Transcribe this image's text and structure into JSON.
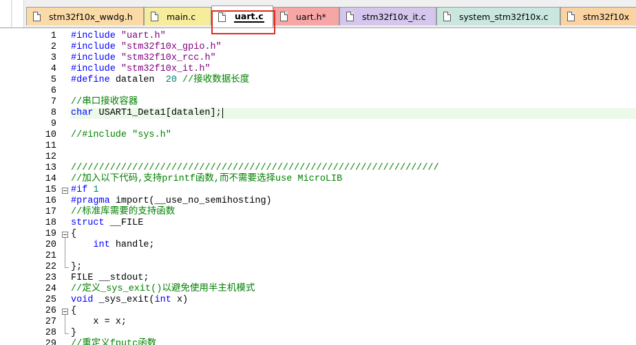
{
  "tabs": [
    {
      "label": "stm32f10x_wwdg.h",
      "color": "#fadba8",
      "active": false
    },
    {
      "label": "main.c",
      "color": "#f7ec9c",
      "active": false
    },
    {
      "label": "uart.c",
      "color": "#ffffff",
      "active": true
    },
    {
      "label": "uart.h*",
      "color": "#f7a6a6",
      "active": false
    },
    {
      "label": "stm32f10x_it.c",
      "color": "#d4c6ec",
      "active": false
    },
    {
      "label": "system_stm32f10x.c",
      "color": "#c9e6df",
      "active": false
    },
    {
      "label": "stm32f10x",
      "color": "#fad3a2",
      "active": false
    }
  ],
  "colors": {
    "keyword": "#0000ff",
    "string": "#800080",
    "comment": "#008000",
    "number": "#008080",
    "current_line": "#ecfaea",
    "highlight_box": "#e0281e"
  },
  "editor": {
    "current_line": 8,
    "lines": [
      {
        "n": "1",
        "fold": "",
        "tokens": [
          [
            "pp",
            "#include "
          ],
          [
            "str",
            "\"uart.h\""
          ]
        ]
      },
      {
        "n": "2",
        "fold": "",
        "tokens": [
          [
            "pp",
            "#include "
          ],
          [
            "str",
            "\"stm32f10x_gpio.h\""
          ]
        ]
      },
      {
        "n": "3",
        "fold": "",
        "tokens": [
          [
            "pp",
            "#include "
          ],
          [
            "str",
            "\"stm32f10x_rcc.h\""
          ]
        ]
      },
      {
        "n": "4",
        "fold": "",
        "tokens": [
          [
            "pp",
            "#include "
          ],
          [
            "str",
            "\"stm32f10x_it.h\""
          ]
        ]
      },
      {
        "n": "5",
        "fold": "",
        "tokens": [
          [
            "pp",
            "#define "
          ],
          [
            "t",
            "datalen  "
          ],
          [
            "num",
            "20"
          ],
          [
            "t",
            " "
          ],
          [
            "cm",
            "//接收数据长度"
          ]
        ]
      },
      {
        "n": "6",
        "fold": "",
        "tokens": []
      },
      {
        "n": "7",
        "fold": "",
        "tokens": [
          [
            "cm",
            "//串口接收容器"
          ]
        ]
      },
      {
        "n": "8",
        "fold": "",
        "tokens": [
          [
            "kw",
            "char"
          ],
          [
            "t",
            " USART1_Deta1[datalen];"
          ]
        ]
      },
      {
        "n": "9",
        "fold": "",
        "tokens": []
      },
      {
        "n": "10",
        "fold": "",
        "tokens": [
          [
            "cm",
            "//#include \"sys.h\""
          ]
        ]
      },
      {
        "n": "11",
        "fold": "",
        "tokens": []
      },
      {
        "n": "12",
        "fold": "",
        "tokens": []
      },
      {
        "n": "13",
        "fold": "",
        "tokens": [
          [
            "cm",
            "//////////////////////////////////////////////////////////////////"
          ]
        ]
      },
      {
        "n": "14",
        "fold": "",
        "tokens": [
          [
            "cm",
            "//加入以下代码,支持printf函数,而不需要选择use MicroLIB"
          ]
        ]
      },
      {
        "n": "15",
        "fold": "open",
        "tokens": [
          [
            "pp",
            "#if "
          ],
          [
            "num",
            "1"
          ]
        ]
      },
      {
        "n": "16",
        "fold": "",
        "tokens": [
          [
            "pp",
            "#pragma "
          ],
          [
            "t",
            "import(__use_no_semihosting)"
          ]
        ]
      },
      {
        "n": "17",
        "fold": "",
        "tokens": [
          [
            "cm",
            "//标准库需要的支持函数"
          ]
        ]
      },
      {
        "n": "18",
        "fold": "",
        "tokens": [
          [
            "kw",
            "struct"
          ],
          [
            "t",
            " __FILE"
          ]
        ]
      },
      {
        "n": "19",
        "fold": "open",
        "tokens": [
          [
            "t",
            "{"
          ]
        ]
      },
      {
        "n": "20",
        "fold": "",
        "tokens": [
          [
            "t",
            "    "
          ],
          [
            "kw",
            "int"
          ],
          [
            "t",
            " handle;"
          ]
        ]
      },
      {
        "n": "21",
        "fold": "",
        "tokens": []
      },
      {
        "n": "22",
        "fold": "end",
        "tokens": [
          [
            "t",
            "};"
          ]
        ]
      },
      {
        "n": "23",
        "fold": "",
        "tokens": [
          [
            "t",
            "FILE __stdout;"
          ]
        ]
      },
      {
        "n": "24",
        "fold": "",
        "tokens": [
          [
            "cm",
            "//定义_sys_exit()以避免使用半主机模式"
          ]
        ]
      },
      {
        "n": "25",
        "fold": "",
        "tokens": [
          [
            "kw",
            "void"
          ],
          [
            "t",
            " _sys_exit("
          ],
          [
            "kw",
            "int"
          ],
          [
            "t",
            " x)"
          ]
        ]
      },
      {
        "n": "26",
        "fold": "open",
        "tokens": [
          [
            "t",
            "{"
          ]
        ]
      },
      {
        "n": "27",
        "fold": "",
        "tokens": [
          [
            "t",
            "    x = x;"
          ]
        ]
      },
      {
        "n": "28",
        "fold": "end",
        "tokens": [
          [
            "t",
            "}"
          ]
        ]
      },
      {
        "n": "29",
        "fold": "",
        "tokens": [
          [
            "cm",
            "//重定义fputc函数"
          ]
        ]
      }
    ]
  }
}
